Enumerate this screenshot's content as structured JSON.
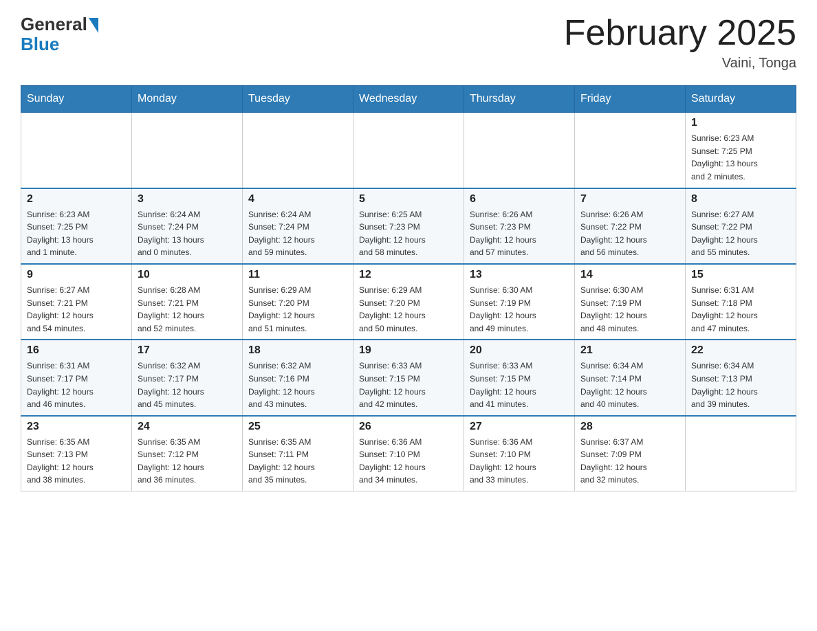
{
  "header": {
    "logo_general": "General",
    "logo_blue": "Blue",
    "month_title": "February 2025",
    "location": "Vaini, Tonga"
  },
  "weekdays": [
    "Sunday",
    "Monday",
    "Tuesday",
    "Wednesday",
    "Thursday",
    "Friday",
    "Saturday"
  ],
  "weeks": [
    [
      {
        "day": "",
        "info": ""
      },
      {
        "day": "",
        "info": ""
      },
      {
        "day": "",
        "info": ""
      },
      {
        "day": "",
        "info": ""
      },
      {
        "day": "",
        "info": ""
      },
      {
        "day": "",
        "info": ""
      },
      {
        "day": "1",
        "info": "Sunrise: 6:23 AM\nSunset: 7:25 PM\nDaylight: 13 hours\nand 2 minutes."
      }
    ],
    [
      {
        "day": "2",
        "info": "Sunrise: 6:23 AM\nSunset: 7:25 PM\nDaylight: 13 hours\nand 1 minute."
      },
      {
        "day": "3",
        "info": "Sunrise: 6:24 AM\nSunset: 7:24 PM\nDaylight: 13 hours\nand 0 minutes."
      },
      {
        "day": "4",
        "info": "Sunrise: 6:24 AM\nSunset: 7:24 PM\nDaylight: 12 hours\nand 59 minutes."
      },
      {
        "day": "5",
        "info": "Sunrise: 6:25 AM\nSunset: 7:23 PM\nDaylight: 12 hours\nand 58 minutes."
      },
      {
        "day": "6",
        "info": "Sunrise: 6:26 AM\nSunset: 7:23 PM\nDaylight: 12 hours\nand 57 minutes."
      },
      {
        "day": "7",
        "info": "Sunrise: 6:26 AM\nSunset: 7:22 PM\nDaylight: 12 hours\nand 56 minutes."
      },
      {
        "day": "8",
        "info": "Sunrise: 6:27 AM\nSunset: 7:22 PM\nDaylight: 12 hours\nand 55 minutes."
      }
    ],
    [
      {
        "day": "9",
        "info": "Sunrise: 6:27 AM\nSunset: 7:21 PM\nDaylight: 12 hours\nand 54 minutes."
      },
      {
        "day": "10",
        "info": "Sunrise: 6:28 AM\nSunset: 7:21 PM\nDaylight: 12 hours\nand 52 minutes."
      },
      {
        "day": "11",
        "info": "Sunrise: 6:29 AM\nSunset: 7:20 PM\nDaylight: 12 hours\nand 51 minutes."
      },
      {
        "day": "12",
        "info": "Sunrise: 6:29 AM\nSunset: 7:20 PM\nDaylight: 12 hours\nand 50 minutes."
      },
      {
        "day": "13",
        "info": "Sunrise: 6:30 AM\nSunset: 7:19 PM\nDaylight: 12 hours\nand 49 minutes."
      },
      {
        "day": "14",
        "info": "Sunrise: 6:30 AM\nSunset: 7:19 PM\nDaylight: 12 hours\nand 48 minutes."
      },
      {
        "day": "15",
        "info": "Sunrise: 6:31 AM\nSunset: 7:18 PM\nDaylight: 12 hours\nand 47 minutes."
      }
    ],
    [
      {
        "day": "16",
        "info": "Sunrise: 6:31 AM\nSunset: 7:17 PM\nDaylight: 12 hours\nand 46 minutes."
      },
      {
        "day": "17",
        "info": "Sunrise: 6:32 AM\nSunset: 7:17 PM\nDaylight: 12 hours\nand 45 minutes."
      },
      {
        "day": "18",
        "info": "Sunrise: 6:32 AM\nSunset: 7:16 PM\nDaylight: 12 hours\nand 43 minutes."
      },
      {
        "day": "19",
        "info": "Sunrise: 6:33 AM\nSunset: 7:15 PM\nDaylight: 12 hours\nand 42 minutes."
      },
      {
        "day": "20",
        "info": "Sunrise: 6:33 AM\nSunset: 7:15 PM\nDaylight: 12 hours\nand 41 minutes."
      },
      {
        "day": "21",
        "info": "Sunrise: 6:34 AM\nSunset: 7:14 PM\nDaylight: 12 hours\nand 40 minutes."
      },
      {
        "day": "22",
        "info": "Sunrise: 6:34 AM\nSunset: 7:13 PM\nDaylight: 12 hours\nand 39 minutes."
      }
    ],
    [
      {
        "day": "23",
        "info": "Sunrise: 6:35 AM\nSunset: 7:13 PM\nDaylight: 12 hours\nand 38 minutes."
      },
      {
        "day": "24",
        "info": "Sunrise: 6:35 AM\nSunset: 7:12 PM\nDaylight: 12 hours\nand 36 minutes."
      },
      {
        "day": "25",
        "info": "Sunrise: 6:35 AM\nSunset: 7:11 PM\nDaylight: 12 hours\nand 35 minutes."
      },
      {
        "day": "26",
        "info": "Sunrise: 6:36 AM\nSunset: 7:10 PM\nDaylight: 12 hours\nand 34 minutes."
      },
      {
        "day": "27",
        "info": "Sunrise: 6:36 AM\nSunset: 7:10 PM\nDaylight: 12 hours\nand 33 minutes."
      },
      {
        "day": "28",
        "info": "Sunrise: 6:37 AM\nSunset: 7:09 PM\nDaylight: 12 hours\nand 32 minutes."
      },
      {
        "day": "",
        "info": ""
      }
    ]
  ]
}
